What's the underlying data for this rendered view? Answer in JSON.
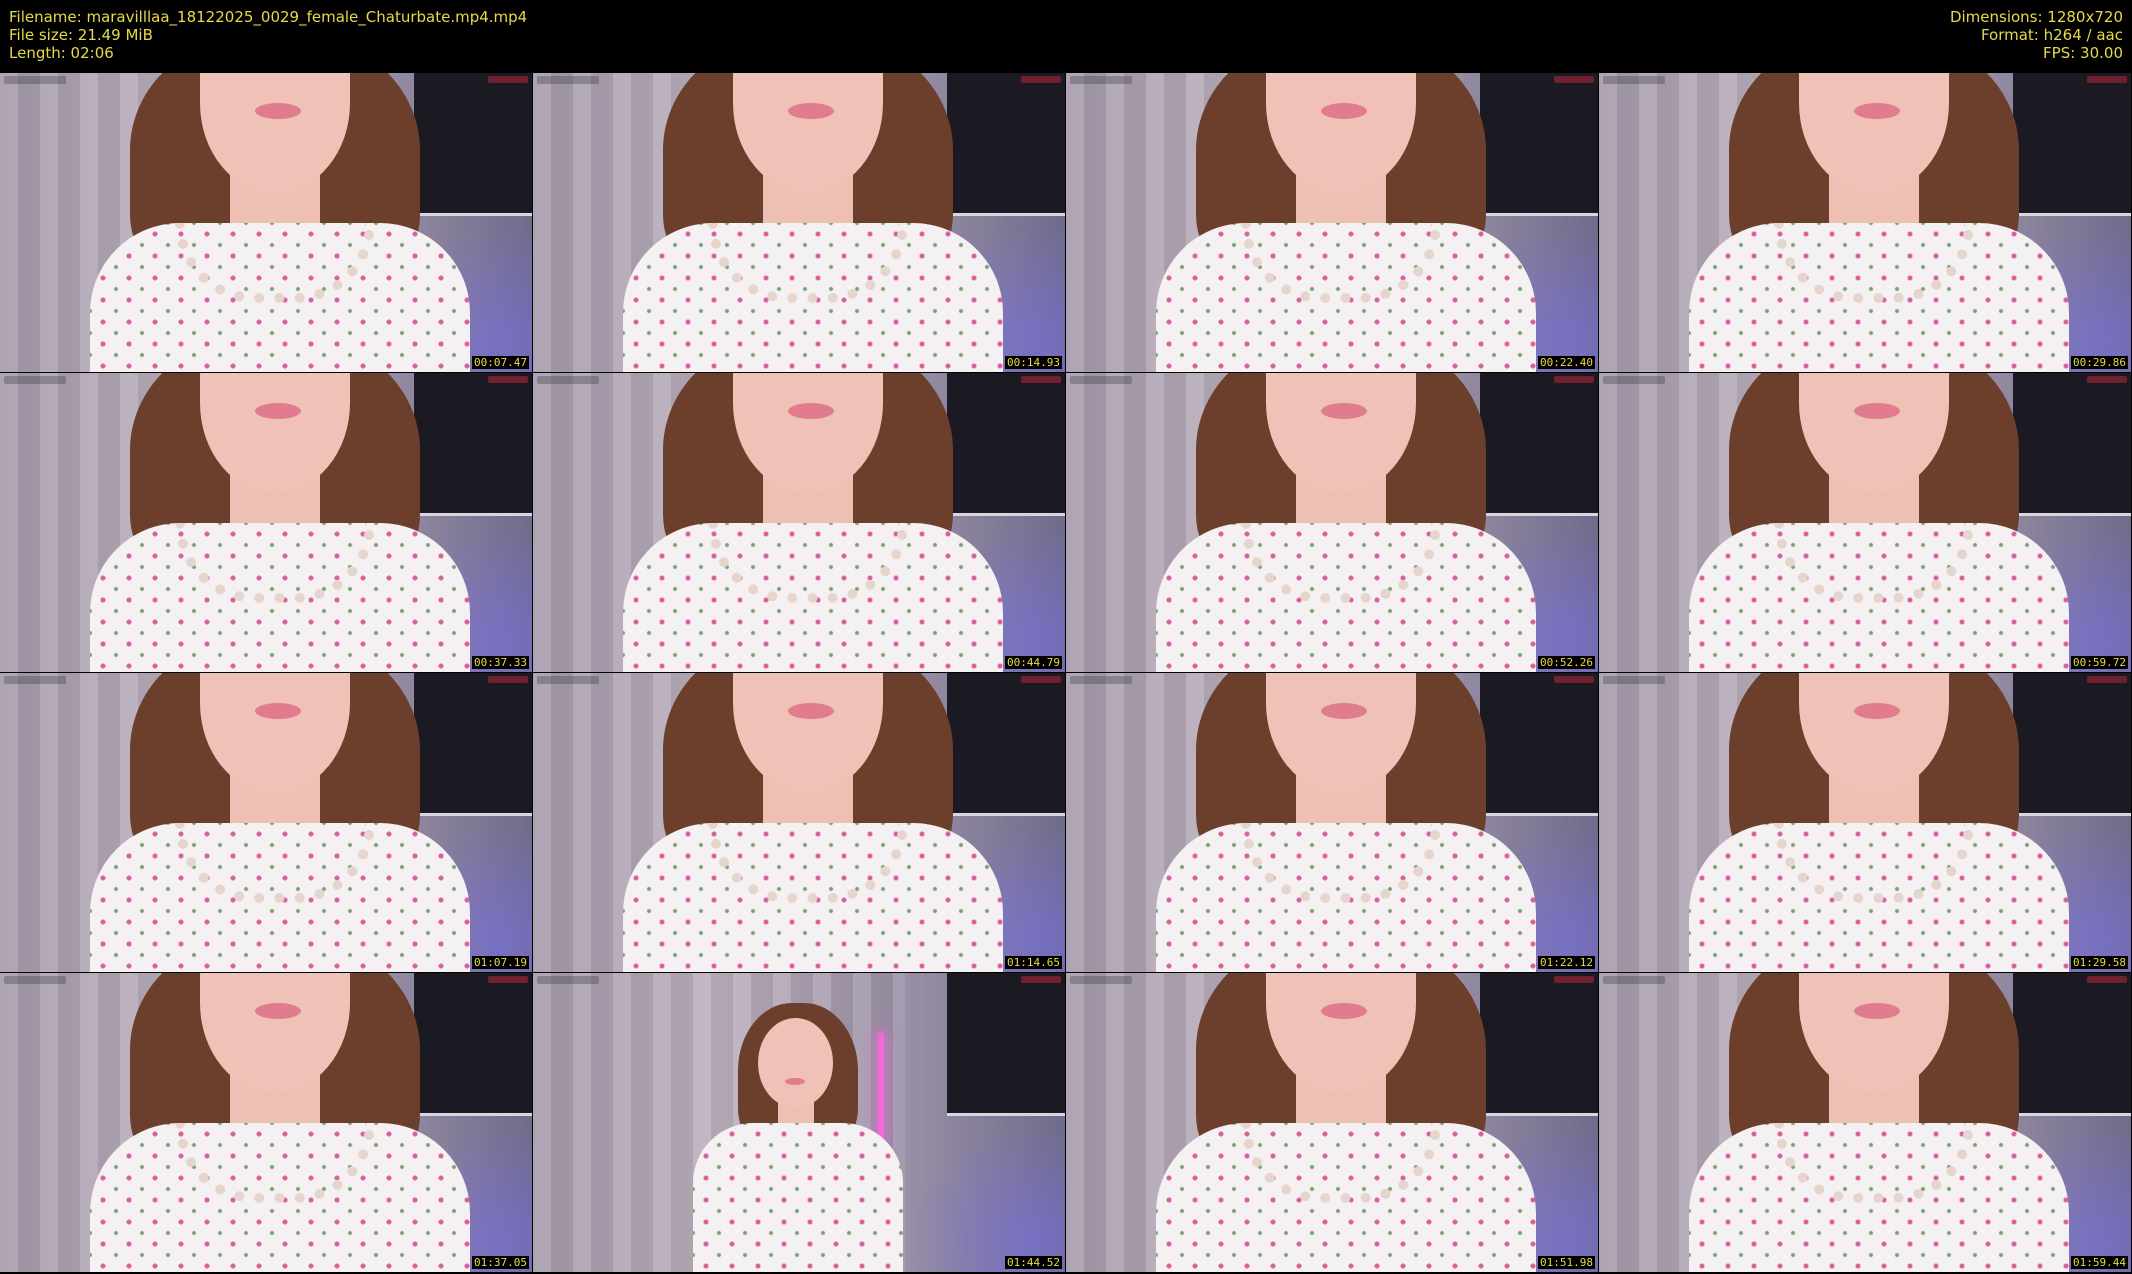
{
  "header": {
    "filename_line": "Filename: maravilllaa_18122025_0029_female_Chaturbate.mp4.mp4",
    "filesize_line": "File size: 21.49 MiB",
    "length_line": "Length: 02:06",
    "dimensions_line": "Dimensions: 1280x720",
    "format_line": "Format: h264 / aac",
    "fps_line": "FPS: 30.00"
  },
  "colors": {
    "header_text": "#e8d94a",
    "background": "#000000"
  },
  "thumbnails": [
    {
      "timestamp": "00:07.47"
    },
    {
      "timestamp": "00:14.93"
    },
    {
      "timestamp": "00:22.40"
    },
    {
      "timestamp": "00:29.86"
    },
    {
      "timestamp": "00:37.33"
    },
    {
      "timestamp": "00:44.79"
    },
    {
      "timestamp": "00:52.26"
    },
    {
      "timestamp": "00:59.72"
    },
    {
      "timestamp": "01:07.19"
    },
    {
      "timestamp": "01:14.65"
    },
    {
      "timestamp": "01:22.12"
    },
    {
      "timestamp": "01:29.58"
    },
    {
      "timestamp": "01:37.05"
    },
    {
      "timestamp": "01:44.52"
    },
    {
      "timestamp": "01:51.98"
    },
    {
      "timestamp": "01:59.44"
    }
  ]
}
